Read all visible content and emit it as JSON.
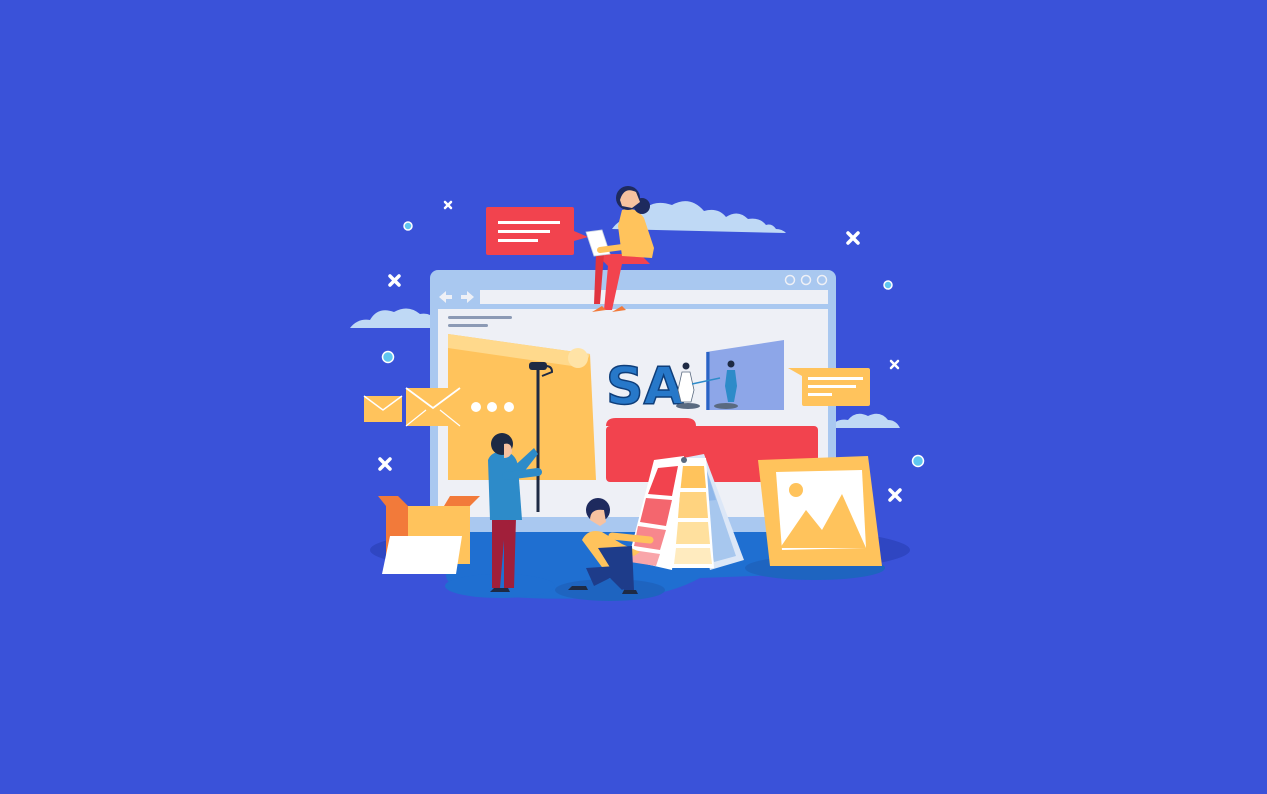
{
  "colors": {
    "background": "#3A52D9",
    "browser_frame": "#A9C8F0",
    "browser_page": "#EEF0F6",
    "platform": "#1F6FD1",
    "red_accent": "#F2434E",
    "yellow_accent": "#FFC35C",
    "orange_accent": "#F27A3A",
    "cloud": "#BFD9F5",
    "dot": "#5FC6F0",
    "logo_text": "#2778C9"
  },
  "logo": {
    "letters": "SA"
  },
  "icons": [
    "cloud-icon",
    "chat-bubble-icon",
    "envelope-icon",
    "more-dots-icon",
    "image-placeholder-icon",
    "color-swatch-icon",
    "paint-roller-icon",
    "box-icon",
    "close-icon",
    "circle-dot-icon",
    "back-arrow-icon",
    "forward-arrow-icon"
  ]
}
